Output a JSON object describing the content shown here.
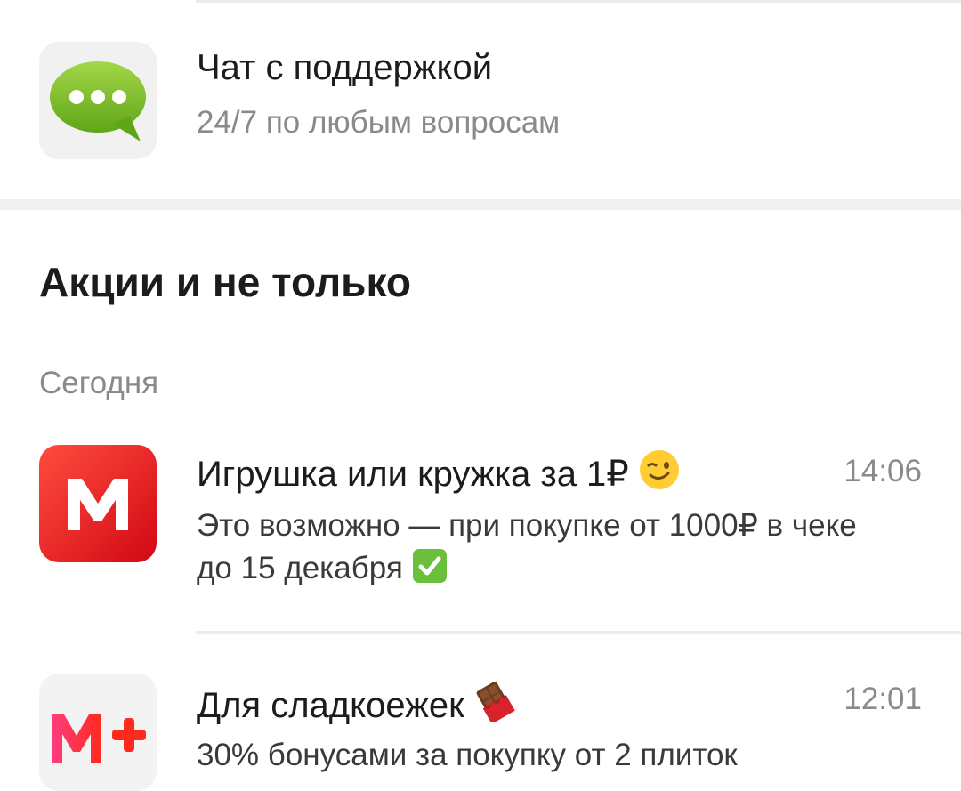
{
  "support": {
    "title": "Чат с поддержкой",
    "subtitle": "24/7 по любым вопросам",
    "icon": "chat-bubble-icon"
  },
  "promotions": {
    "section_title": "Акции и не только",
    "date_label": "Сегодня",
    "items": [
      {
        "title": "Игрушка или кружка за 1₽",
        "title_emoji": "winking-face-icon",
        "time": "14:06",
        "body": "Это возможно — при покупке от 1000₽ в чеке до 15 декабря",
        "body_emoji": "check-mark-button-icon",
        "icon": "magnit-logo-icon"
      },
      {
        "title": "Для сладкоежек",
        "title_emoji": "chocolate-bar-icon",
        "time": "12:01",
        "body": "30% бонусами за покупку от 2 плиток",
        "icon": "magnit-plus-logo-icon"
      }
    ]
  },
  "colors": {
    "accent_red": "#e3141c",
    "chat_green": "#7cc21e",
    "text_primary": "#1c1c1c",
    "text_secondary": "#8a8a8a",
    "separator": "#f0f0f0"
  }
}
